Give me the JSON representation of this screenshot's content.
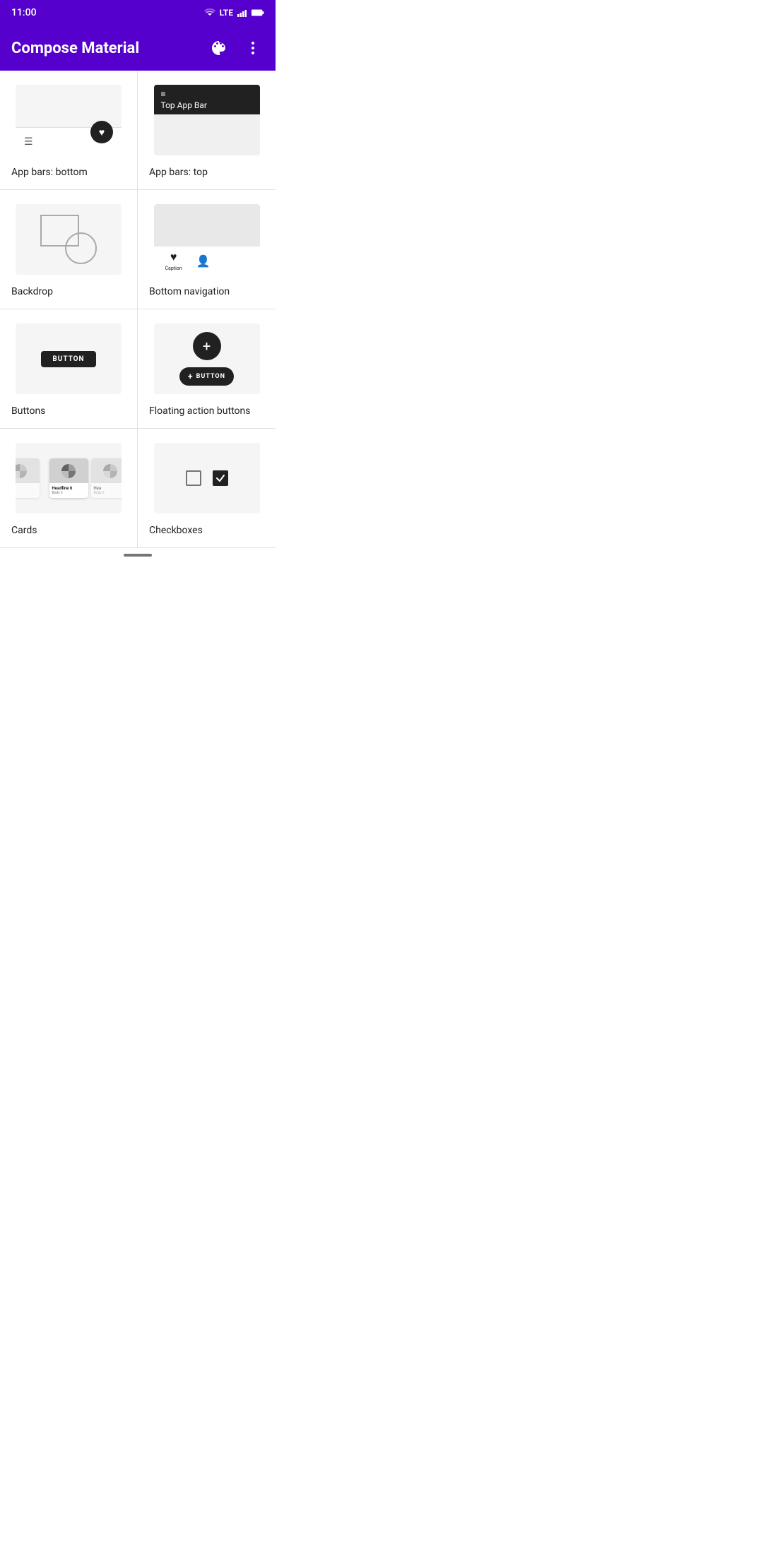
{
  "statusBar": {
    "time": "11:00",
    "icons": [
      "wifi",
      "lte",
      "signal",
      "battery"
    ]
  },
  "appBar": {
    "title": "Compose Material",
    "paletteIcon": "palette-icon",
    "moreIcon": "more-vert-icon"
  },
  "grid": {
    "items": [
      {
        "id": "app-bars-bottom",
        "label": "App bars: bottom",
        "preview": "bottom-app-bar"
      },
      {
        "id": "app-bars-top",
        "label": "App bars: top",
        "preview": "top-app-bar",
        "previewText": "Top App Bar"
      },
      {
        "id": "backdrop",
        "label": "Backdrop",
        "preview": "backdrop"
      },
      {
        "id": "bottom-navigation",
        "label": "Bottom navigation",
        "preview": "bottom-nav",
        "captionText": "Caption"
      },
      {
        "id": "buttons",
        "label": "Buttons",
        "preview": "buttons",
        "buttonText": "BUTTON"
      },
      {
        "id": "floating-action-buttons",
        "label": "Floating action buttons",
        "preview": "fab",
        "buttonText": "BUTTON"
      },
      {
        "id": "cards",
        "label": "Cards",
        "preview": "cards",
        "cardHeadline": "Headline 6",
        "cardBody": "Body 2"
      },
      {
        "id": "checkboxes",
        "label": "Checkboxes",
        "preview": "checkboxes"
      }
    ]
  }
}
